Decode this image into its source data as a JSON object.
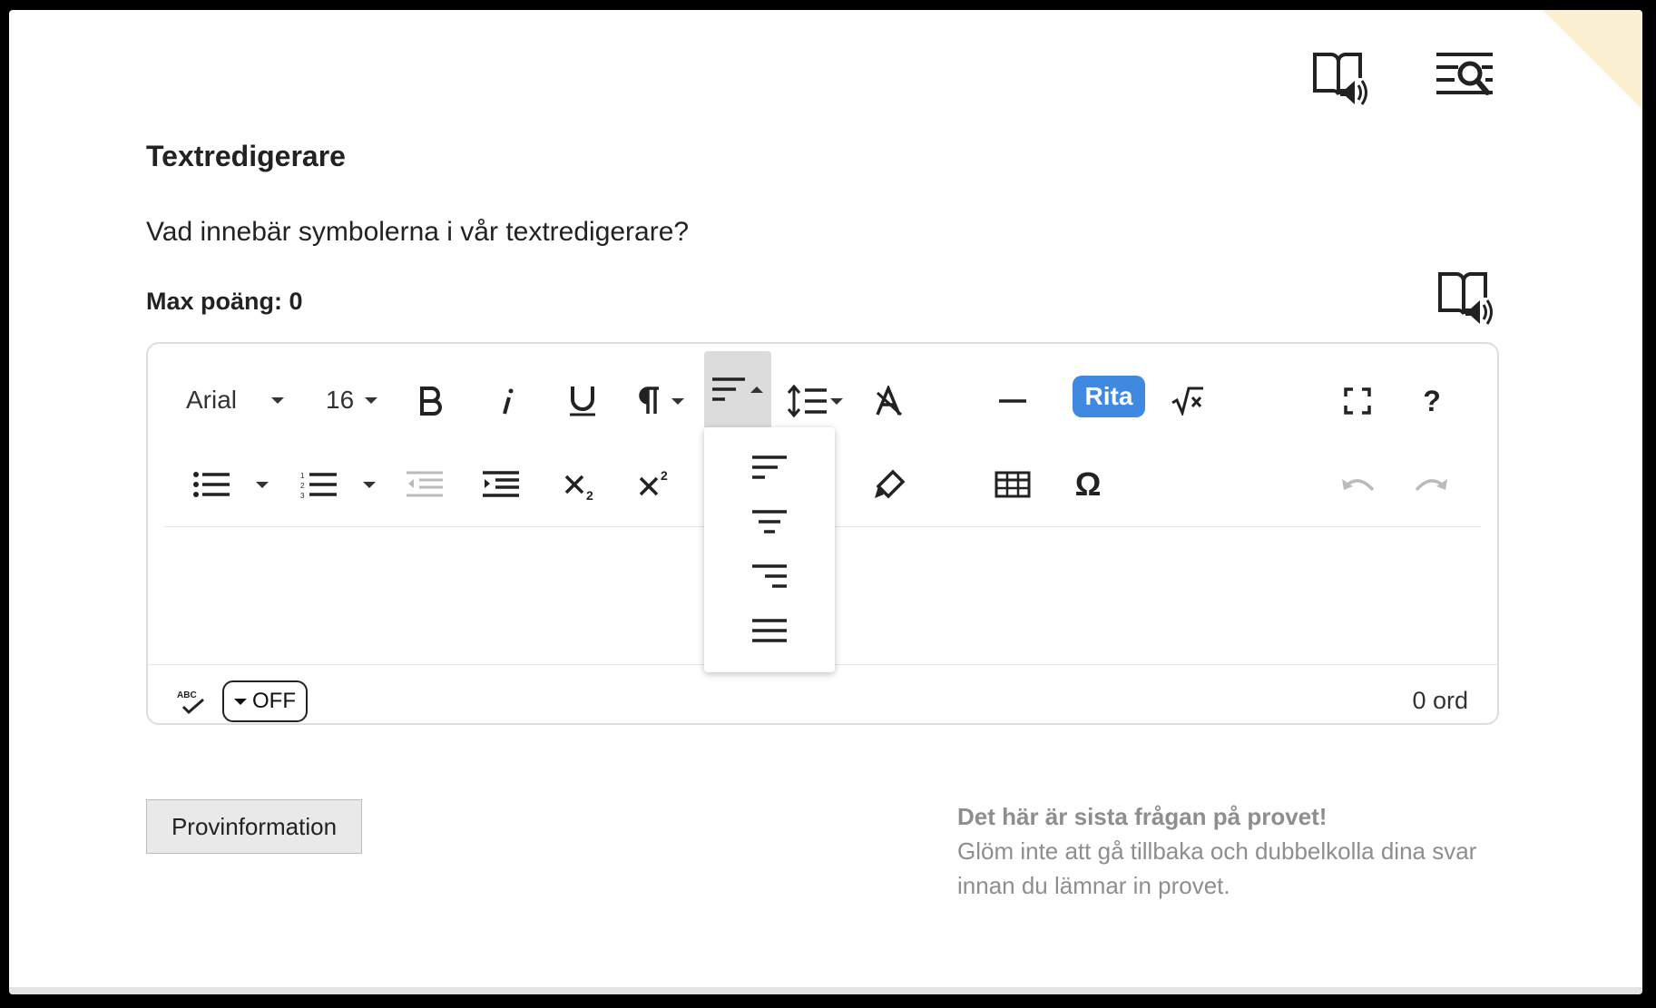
{
  "header": {
    "listen_page_icon": "book-speaker-icon",
    "search_text_icon": "text-search-icon"
  },
  "question": {
    "title": "Textredigerare",
    "text": "Vad innebär symbolerna i vår textredigerare?",
    "max_points": "Max poäng: 0",
    "listen_icon": "book-speaker-icon"
  },
  "editor": {
    "font_family": "Arial",
    "font_size": "16",
    "rita_label": "Rita",
    "help_label": "?",
    "omega_label": "Ω",
    "alignment_options": [
      "align-left-icon",
      "align-center-icon",
      "align-right-icon",
      "align-justify-icon"
    ],
    "spellcheck_label": "OFF",
    "word_count": "0 ord",
    "colors": {
      "rita": "#3f8ae0",
      "toolbar_active": "#dcdcdc"
    }
  },
  "footer": {
    "info_button": "Provinformation",
    "note_title": "Det här är sista frågan på provet!",
    "note_text": "Glöm inte att gå tillbaka och dubbelkolla dina svar innan du lämnar in provet."
  }
}
